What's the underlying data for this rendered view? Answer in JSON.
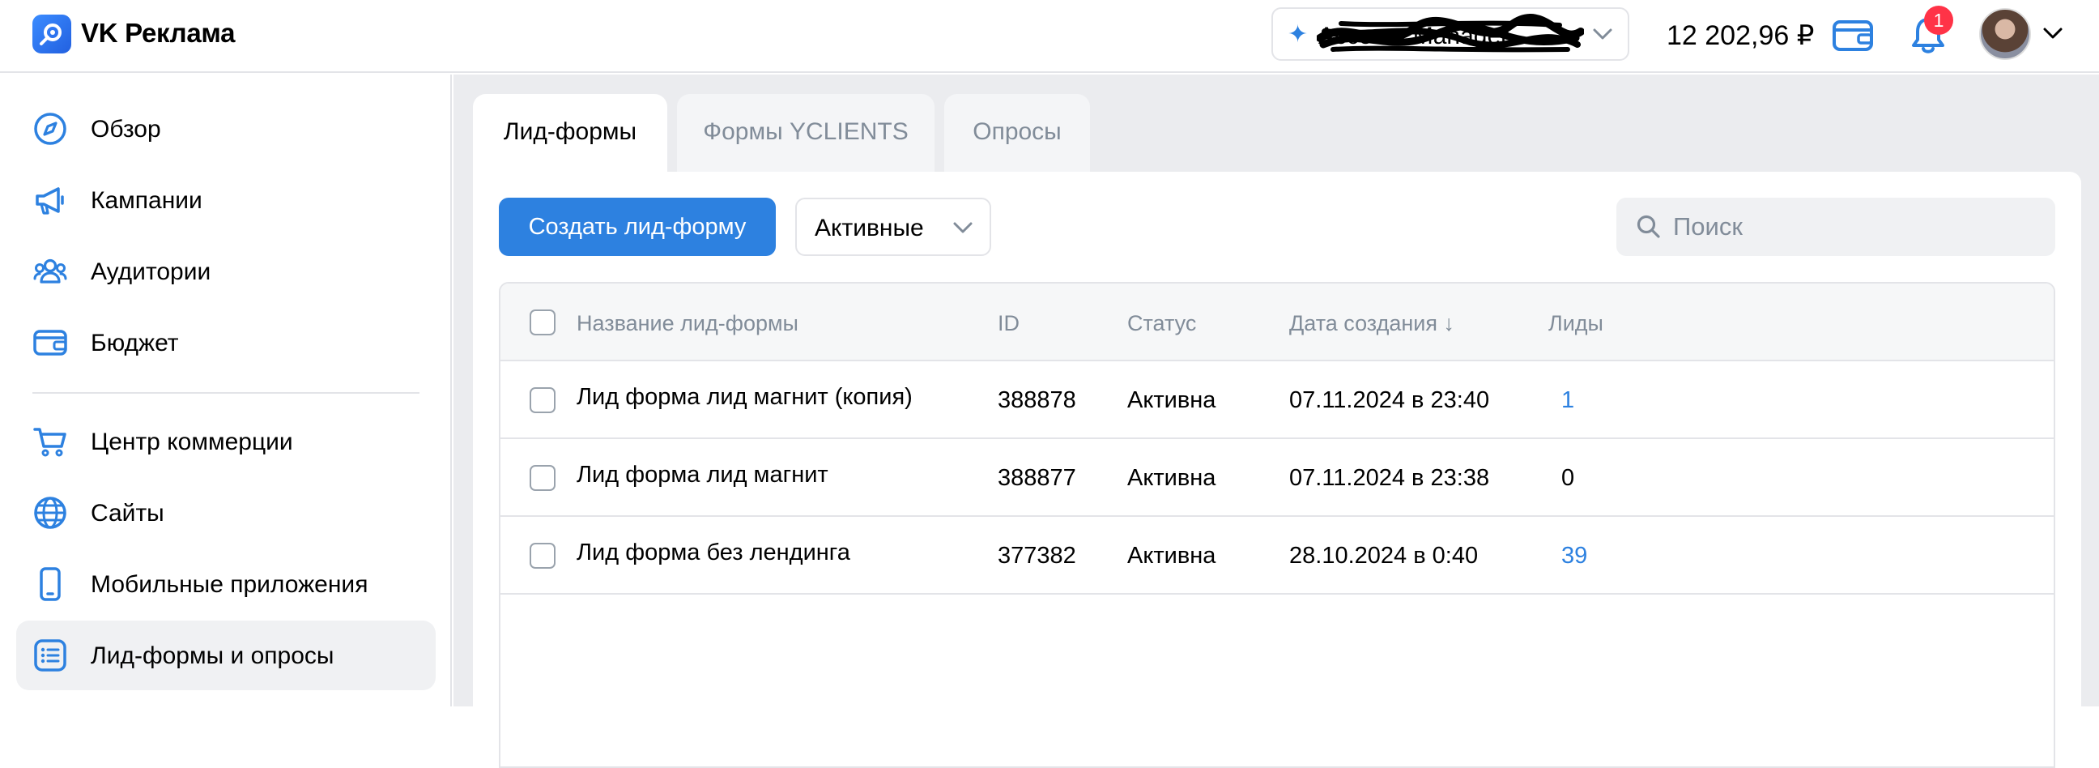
{
  "header": {
    "brand": "VK Реклама",
    "account_name": "Account Manager",
    "balance": "12 202,96 ₽",
    "notifications_count": "1",
    "icons": [
      "vk-ads-logo-icon",
      "sparkle-icon",
      "chevron-down-icon",
      "wallet-icon",
      "bell-icon",
      "avatar"
    ]
  },
  "sidebar": {
    "items": [
      {
        "label": "Обзор",
        "icon": "compass-icon"
      },
      {
        "label": "Кампании",
        "icon": "megaphone-icon"
      },
      {
        "label": "Аудитории",
        "icon": "users-icon"
      },
      {
        "label": "Бюджет",
        "icon": "wallet-icon"
      },
      {
        "label": "Центр коммерции",
        "icon": "cart-icon"
      },
      {
        "label": "Сайты",
        "icon": "globe-icon"
      },
      {
        "label": "Мобильные приложения",
        "icon": "smartphone-icon"
      },
      {
        "label": "Лид-формы и опросы",
        "icon": "list-icon",
        "active": true
      }
    ]
  },
  "tabs": [
    {
      "label": "Лид-формы",
      "active": true
    },
    {
      "label": "Формы YCLIENTS",
      "active": false
    },
    {
      "label": "Опросы",
      "active": false
    }
  ],
  "toolbar": {
    "create_label": "Создать лид-форму",
    "filter_value": "Активные",
    "search_placeholder": "Поиск"
  },
  "table": {
    "headers": {
      "name": "Название лид-формы",
      "id": "ID",
      "status": "Статус",
      "created": "Дата создания ↓",
      "leads": "Лиды"
    },
    "rows": [
      {
        "name": "Лид форма лид магнит (копия)",
        "id": "388878",
        "status": "Активна",
        "created": "07.11.2024 в 23:40",
        "leads": "1"
      },
      {
        "name": "Лид форма лид магнит",
        "id": "388877",
        "status": "Активна",
        "created": "07.11.2024 в 23:38",
        "leads": "0"
      },
      {
        "name": "Лид форма без лендинга",
        "id": "377382",
        "status": "Активна",
        "created": "28.10.2024 в 0:40",
        "leads": "39"
      }
    ]
  },
  "colors": {
    "accent": "#2d81e0",
    "badge": "#ff3347",
    "muted_text": "#818c99",
    "page_bg": "#ebecef",
    "border": "#e3e4e8"
  }
}
